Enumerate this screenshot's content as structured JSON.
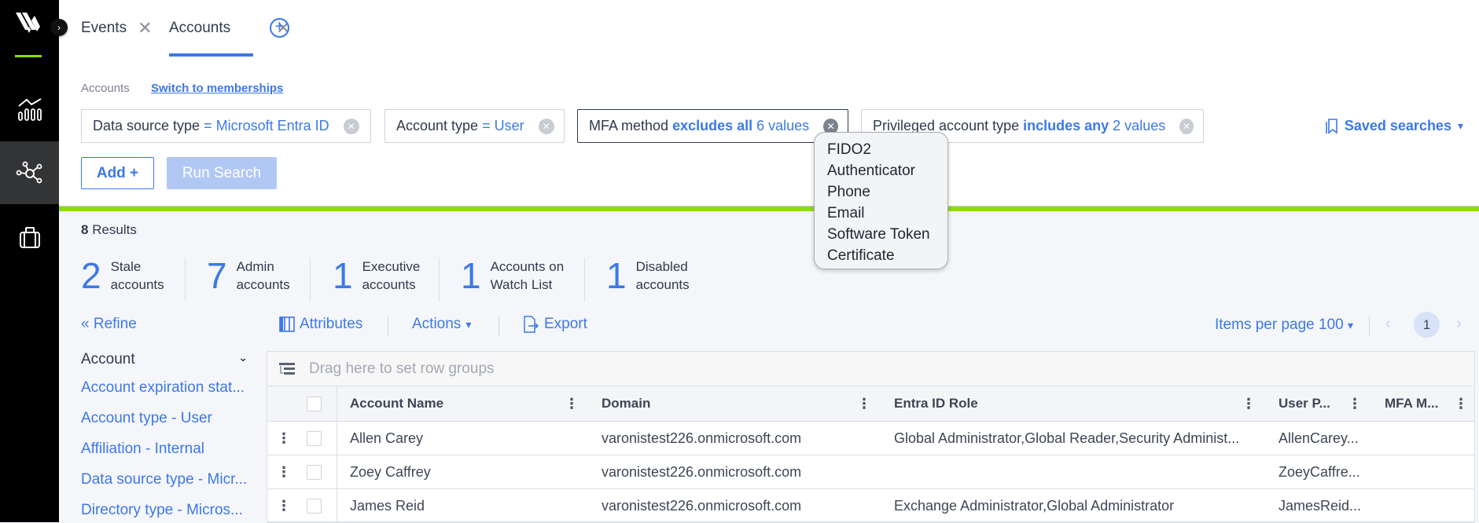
{
  "tabs": [
    {
      "label": "Events",
      "active": false
    },
    {
      "label": "Accounts",
      "active": true
    }
  ],
  "search": {
    "entity_label": "Accounts",
    "switch_link": "Switch to memberships",
    "filters": [
      {
        "field": "Data source type",
        "op_bold": "",
        "op": "= Microsoft Entra ID"
      },
      {
        "field": "Account type",
        "op_bold": "",
        "op": "= User"
      },
      {
        "field": "MFA method",
        "op_bold": "excludes all",
        "op": "6 values"
      },
      {
        "field": "Privileged account type",
        "op_bold": "includes any",
        "op": "2 values"
      }
    ],
    "saved_searches": "Saved searches",
    "add_label": "Add +",
    "run_label": "Run Search"
  },
  "mfa_popover": {
    "values": [
      "FIDO2",
      "Authenticator",
      "Phone",
      "Email",
      "Software Token",
      "Certificate"
    ]
  },
  "results": {
    "count": "8",
    "label": "Results",
    "stats": [
      {
        "value": "2",
        "line1": "Stale",
        "line2": "accounts"
      },
      {
        "value": "7",
        "line1": "Admin",
        "line2": "accounts"
      },
      {
        "value": "1",
        "line1": "Executive",
        "line2": "accounts"
      },
      {
        "value": "1",
        "line1": "Accounts on",
        "line2": "Watch List"
      },
      {
        "value": "1",
        "line1": "Disabled",
        "line2": "accounts"
      }
    ]
  },
  "toolbar": {
    "refine": "Refine",
    "attributes": "Attributes",
    "actions": "Actions",
    "export": "Export",
    "items_per_page_label": "Items per page",
    "items_per_page_value": "100",
    "current_page": "1"
  },
  "facets": {
    "group": "Account",
    "items": [
      "Account expiration stat...",
      "Account type - User",
      "Affiliation - Internal",
      "Data source type - Micr...",
      "Directory type - Micros..."
    ]
  },
  "grid": {
    "row_groups_placeholder": "Drag here to set row groups",
    "columns": [
      "Account Name",
      "Domain",
      "Entra ID Role",
      "User P...",
      "MFA M..."
    ],
    "rows": [
      {
        "name": "Allen Carey",
        "domain": "varonistest226.onmicrosoft.com",
        "role": "Global Administrator,Global Reader,Security Administ...",
        "upn": "AllenCarey...",
        "mfa": ""
      },
      {
        "name": "Zoey Caffrey",
        "domain": "varonistest226.onmicrosoft.com",
        "role": "",
        "upn": "ZoeyCaffre...",
        "mfa": ""
      },
      {
        "name": "James Reid",
        "domain": "varonistest226.onmicrosoft.com",
        "role": "Exchange Administrator,Global Administrator",
        "upn": "JamesReid...",
        "mfa": ""
      }
    ]
  },
  "colors": {
    "accent": "#3c78e8",
    "brand_green": "#8fdc00",
    "sidebar": "#000000"
  }
}
